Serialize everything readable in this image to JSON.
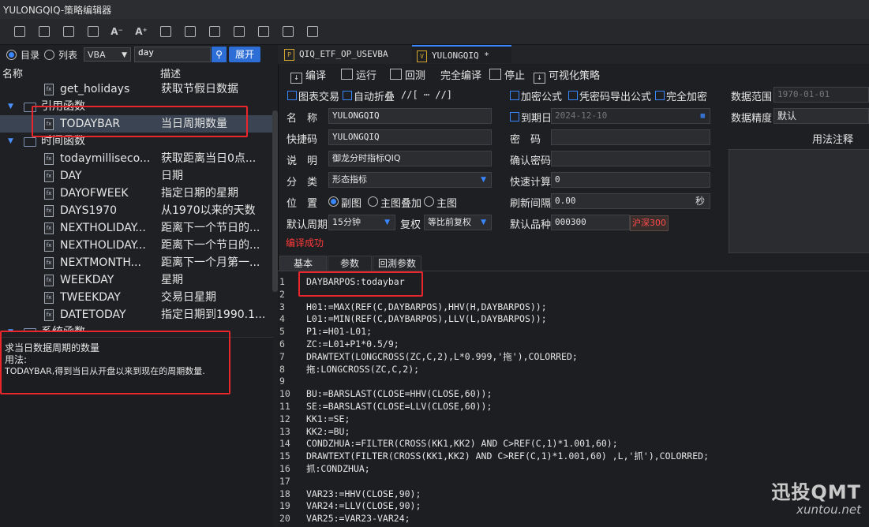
{
  "window": {
    "title": "YULONGQIQ-策略编辑器"
  },
  "left": {
    "mode_dir": "目录",
    "mode_list": "列表",
    "lang_select": "VBA",
    "search_value": "day",
    "expand_label": "展开",
    "col_name": "名称",
    "col_desc": "描述",
    "tree": [
      {
        "type": "item",
        "name": "get_holidays",
        "desc": "获取节假日数据"
      },
      {
        "type": "group",
        "name": "引用函数"
      },
      {
        "type": "item",
        "name": "TODAYBAR",
        "desc": "当日周期数量",
        "selected": true
      },
      {
        "type": "group",
        "name": "时间函数"
      },
      {
        "type": "item",
        "name": "todaymilliseco...",
        "desc": "获取距离当日0点..."
      },
      {
        "type": "item",
        "name": "DAY",
        "desc": "日期"
      },
      {
        "type": "item",
        "name": "DAYOFWEEK",
        "desc": "指定日期的星期"
      },
      {
        "type": "item",
        "name": "DAYS1970",
        "desc": "从1970以来的天数"
      },
      {
        "type": "item",
        "name": "NEXTHOLIDAY...",
        "desc": "距离下一个节日的..."
      },
      {
        "type": "item",
        "name": "NEXTHOLIDAY...",
        "desc": "距离下一个节日的..."
      },
      {
        "type": "item",
        "name": "NEXTMONTH...",
        "desc": "距离下一个月第一..."
      },
      {
        "type": "item",
        "name": "WEEKDAY",
        "desc": "星期"
      },
      {
        "type": "item",
        "name": "TWEEKDAY",
        "desc": "交易日星期"
      },
      {
        "type": "item",
        "name": "DATETODAY",
        "desc": "指定日期到1990.1..."
      },
      {
        "type": "group",
        "name": "系统函数"
      }
    ],
    "help": {
      "summary": "求当日数据周期的数量",
      "usage_label": "用法:",
      "usage": "TODAYBAR,得到当日从开盘以来到现在的周期数量."
    }
  },
  "tabs": [
    {
      "icon": "P",
      "label": "QIQ_ETF_OP_USEVBA"
    },
    {
      "icon": "V",
      "label": "YULONGQIQ *"
    }
  ],
  "actions": [
    "编译",
    "运行",
    "回测",
    "完全编译",
    "停止",
    "可视化策略"
  ],
  "form": {
    "chk_chart_trade": "图表交易",
    "chk_auto_fold": "自动折叠",
    "comment_toggle": "//[ ⋯ //]",
    "chk_encrypt_formula": "加密公式",
    "chk_export_with_pwd": "凭密码导出公式",
    "chk_full_encrypt": "完全加密",
    "data_range_label": "数据范围",
    "data_range_value": "1970-01-01",
    "name_label": "名　称",
    "name_value": "YULONGQIQ",
    "expire_label": "到期日",
    "expire_value": "2024-12-10",
    "precision_label": "数据精度",
    "precision_value": "默认",
    "shortcut_label": "快捷码",
    "shortcut_value": "YULONGQIQ",
    "password_label": "密　码",
    "password_value": "",
    "usage_notes_label": "用法注释",
    "desc_label": "说　明",
    "desc_value": "御龙分时指标QIQ",
    "confirm_pwd_label": "确认密码",
    "confirm_pwd_value": "",
    "category_label": "分　类",
    "category_value": "形态指标",
    "quick_calc_label": "快速计算",
    "quick_calc_value": "0",
    "position_label": "位　置",
    "pos_sub": "副图",
    "pos_overlay": "主图叠加",
    "pos_main": "主图",
    "refresh_label": "刷新间隔",
    "refresh_value": "0.00",
    "refresh_unit": "秒",
    "period_label": "默认周期",
    "period_value": "15分钟",
    "adjust_label": "复权",
    "adjust_value": "等比前复权",
    "symbol_label": "默认品种",
    "symbol_value": "000300",
    "symbol_market": "沪深300",
    "compile_status": "编译成功"
  },
  "subtabs": [
    "基本",
    "参数",
    "回測参数"
  ],
  "code": [
    "DAYBARPOS:todaybar",
    "",
    "H01:=MAX(REF(C,DAYBARPOS),HHV(H,DAYBARPOS));",
    "L01:=MIN(REF(C,DAYBARPOS),LLV(L,DAYBARPOS));",
    "P1:=H01-L01;",
    "ZC:=L01+P1*0.5/9;",
    "DRAWTEXT(LONGCROSS(ZC,C,2),L*0.999,'拖'),COLORRED;",
    "拖:LONGCROSS(ZC,C,2);",
    "",
    "BU:=BARSLAST(CLOSE=HHV(CLOSE,60));",
    "SE:=BARSLAST(CLOSE=LLV(CLOSE,60));",
    "KK1:=SE;",
    "KK2:=BU;",
    "CONDZHUA:=FILTER(CROSS(KK1,KK2) AND C>REF(C,1)*1.001,60);",
    "DRAWTEXT(FILTER(CROSS(KK1,KK2) AND C>REF(C,1)*1.001,60) ,L,'抓'),COLORRED;",
    "抓:CONDZHUA;",
    "",
    "VAR23:=HHV(CLOSE,90);",
    "VAR24:=LLV(CLOSE,90);",
    "VAR25:=VAR23-VAR24;"
  ],
  "watermark": {
    "brand": "迅投QMT",
    "url": "xuntou.net"
  },
  "colors": {
    "accent": "#2c6ed5",
    "highlight": "#e8262c",
    "keyword": "#e8d44d",
    "error": "#ff3a3a"
  }
}
